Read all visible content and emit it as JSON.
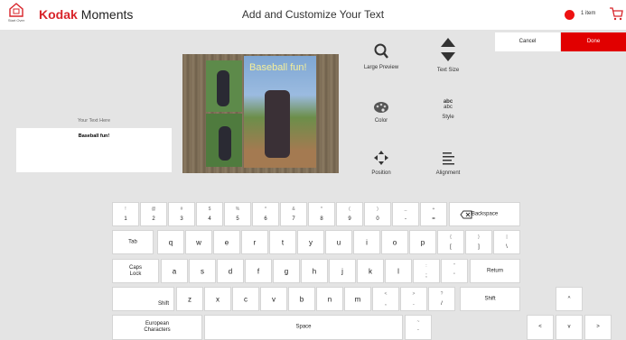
{
  "header": {
    "home_label": "Start Over",
    "brand_bold": "Kodak",
    "brand_text": "Moments",
    "title": "Add and Customize Your Text",
    "cart_count": "1 item"
  },
  "actions": {
    "cancel_label": "Cancel",
    "done_label": "Done"
  },
  "text_entry": {
    "label": "Your Text Here",
    "value": "Baseball fun!"
  },
  "preview": {
    "caption": "Baseball fun!"
  },
  "tools": {
    "large_preview": "Large Preview",
    "text_size": "Text Size",
    "color": "Color",
    "style": "Style",
    "style_glyph": "abc",
    "position": "Position",
    "alignment": "Alignment"
  },
  "keyboard": {
    "row1": [
      {
        "top": "!",
        "bot": "1"
      },
      {
        "top": "@",
        "bot": "2"
      },
      {
        "top": "#",
        "bot": "3"
      },
      {
        "top": "$",
        "bot": "4"
      },
      {
        "top": "%",
        "bot": "5"
      },
      {
        "top": "^",
        "bot": "6"
      },
      {
        "top": "&",
        "bot": "7"
      },
      {
        "top": "*",
        "bot": "8"
      },
      {
        "top": "(",
        "bot": "9"
      },
      {
        "top": ")",
        "bot": "0"
      },
      {
        "top": "_",
        "bot": "-"
      },
      {
        "top": "+",
        "bot": "="
      }
    ],
    "backspace": "Backspace",
    "tab": "Tab",
    "row2": [
      "q",
      "w",
      "e",
      "r",
      "t",
      "y",
      "u",
      "i",
      "o",
      "p"
    ],
    "row2_extra": [
      {
        "top": "{",
        "bot": "["
      },
      {
        "top": "}",
        "bot": "]"
      },
      {
        "top": "|",
        "bot": "\\"
      }
    ],
    "caps": "Caps\nLock",
    "row3": [
      "a",
      "s",
      "d",
      "f",
      "g",
      "h",
      "j",
      "k",
      "l"
    ],
    "row3_extra": [
      {
        "top": ":",
        "bot": ";"
      },
      {
        "top": "\"",
        "bot": "'"
      }
    ],
    "return": "Return",
    "shift": "Shift",
    "row4": [
      "z",
      "x",
      "c",
      "v",
      "b",
      "n",
      "m"
    ],
    "row4_extra": [
      {
        "top": "<",
        "bot": ","
      },
      {
        "top": ">",
        "bot": "."
      },
      {
        "top": "?",
        "bot": "/"
      }
    ],
    "european": "European\nCharacters",
    "space": "Space",
    "tilde": {
      "top": "~",
      "bot": "`"
    },
    "arrows": {
      "up": "^",
      "left": "<",
      "down": "v",
      "right": ">"
    }
  }
}
